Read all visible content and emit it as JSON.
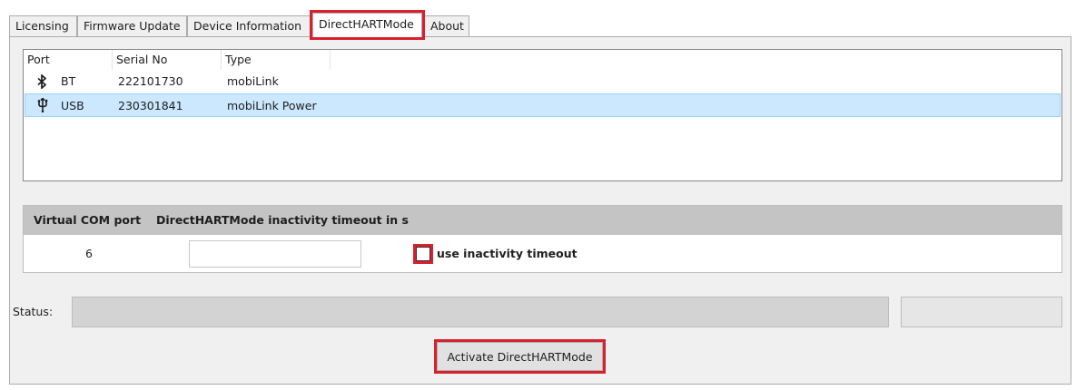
{
  "tabs": [
    {
      "label": "Licensing"
    },
    {
      "label": "Firmware Update"
    },
    {
      "label": "Device Information"
    },
    {
      "label": "DirectHARTMode",
      "active": true
    },
    {
      "label": "About"
    }
  ],
  "device_list": {
    "columns": [
      "Port",
      "Serial No",
      "Type"
    ],
    "rows": [
      {
        "icon": "bluetooth-icon",
        "port": "BT",
        "serial": "222101730",
        "type": "mobiLink",
        "selected": false
      },
      {
        "icon": "usb-icon",
        "port": "USB",
        "serial": "230301841",
        "type": "mobiLink Power",
        "selected": true
      }
    ]
  },
  "com_table": {
    "col_virtual_com": "Virtual COM port",
    "col_timeout": "DirectHARTMode inactivity timeout in s",
    "virtual_com_value": "6",
    "timeout_value": "",
    "use_timeout_label": "use inactivity timeout",
    "use_timeout_checked": false
  },
  "status": {
    "label": "Status:",
    "text": ""
  },
  "actions": {
    "activate_label": "Activate DirectHARTMode"
  },
  "colors": {
    "highlight": "#d8202e",
    "selection": "#cce8ff"
  }
}
